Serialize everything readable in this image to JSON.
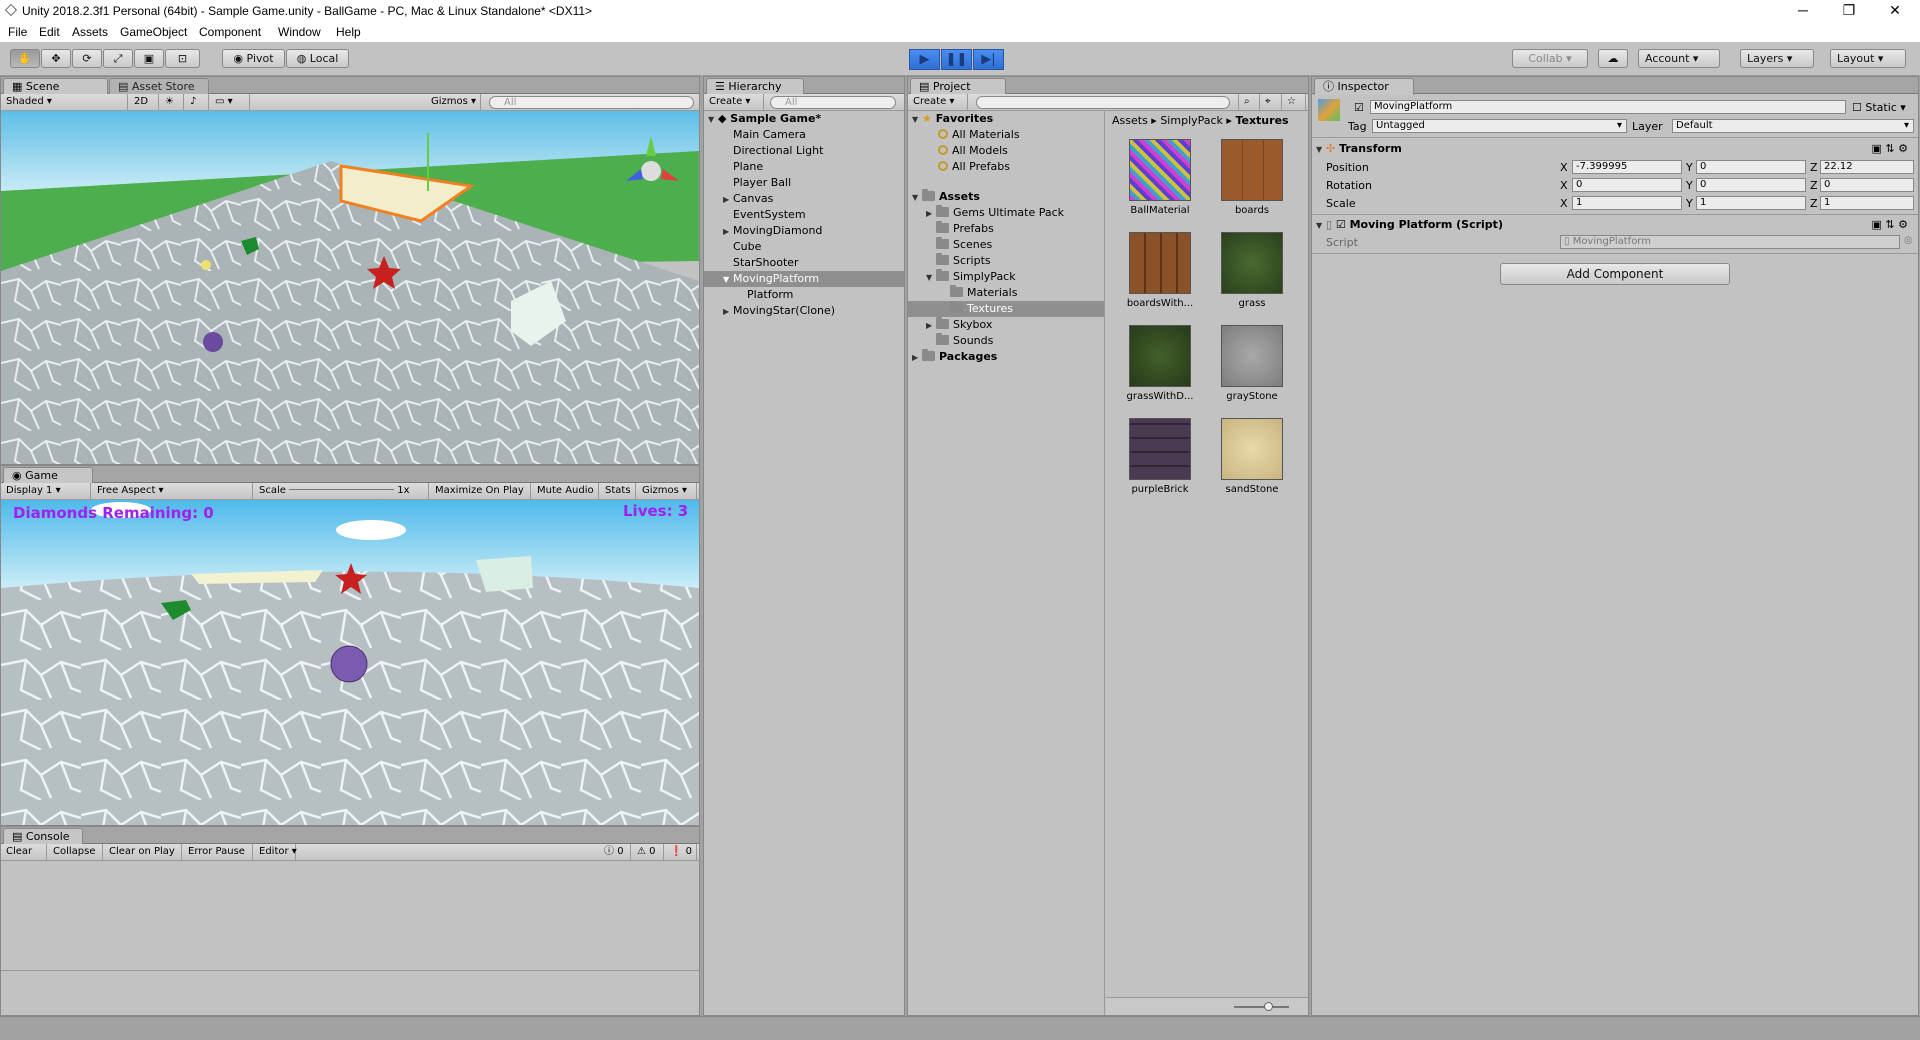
{
  "window": {
    "title": "Unity 2018.2.3f1 Personal (64bit) - Sample Game.unity - BallGame - PC, Mac & Linux Standalone* <DX11>",
    "minimize": "─",
    "restore": "❐",
    "close": "✕"
  },
  "menu": [
    "File",
    "Edit",
    "Assets",
    "GameObject",
    "Component",
    "Window",
    "Help"
  ],
  "toolbar": {
    "pivot": "Pivot",
    "local": "Local",
    "collab": "Collab ▾",
    "account": "Account",
    "layers": "Layers",
    "layout": "Layout",
    "tools": [
      "✋",
      "✥",
      "⟳",
      "⤢",
      "▣",
      "⊡"
    ],
    "play": "▶",
    "pause": "❚❚",
    "step": "▶|"
  },
  "scene": {
    "tabs": [
      "Scene",
      "Asset Store"
    ],
    "shading": "Shaded",
    "mode2d": "2D",
    "gizmos": "Gizmos",
    "search_placeholder": "All"
  },
  "game": {
    "tab": "Game",
    "display": "Display 1",
    "aspect": "Free Aspect",
    "scale_label": "Scale",
    "scale_value": "1x",
    "maximize": "Maximize On Play",
    "mute": "Mute Audio",
    "stats": "Stats",
    "gizmos": "Gizmos",
    "hud_diamonds": "Diamonds Remaining: 0",
    "hud_lives": "Lives: 3"
  },
  "console": {
    "tab": "Console",
    "buttons": [
      "Clear",
      "Collapse",
      "Clear on Play",
      "Error Pause",
      "Editor"
    ],
    "info_count": "0",
    "warn_count": "0",
    "error_count": "0"
  },
  "hierarchy": {
    "tab": "Hierarchy",
    "create": "Create",
    "search_placeholder": "All",
    "scene": "Sample Game*",
    "items": [
      "Main Camera",
      "Directional Light",
      "Plane",
      "Player Ball",
      "Canvas",
      "EventSystem",
      "MovingDiamond",
      "Cube",
      "StarShooter",
      "MovingPlatform",
      "Platform",
      "MovingStar(Clone)"
    ]
  },
  "project": {
    "tab": "Project",
    "create": "Create",
    "favorites": "Favorites",
    "favorite_items": [
      "All Materials",
      "All Models",
      "All Prefabs"
    ],
    "assets": "Assets",
    "folders": [
      "Gems Ultimate Pack",
      "Prefabs",
      "Scenes",
      "Scripts",
      "SimplyPack",
      "Materials",
      "Textures",
      "Skybox",
      "Sounds"
    ],
    "packages": "Packages",
    "breadcrumb": [
      "Assets",
      "SimplyPack",
      "Textures"
    ],
    "thumbnails": [
      {
        "name": "BallMaterial"
      },
      {
        "name": "boards"
      },
      {
        "name": "boardsWith..."
      },
      {
        "name": "grass"
      },
      {
        "name": "grassWithD..."
      },
      {
        "name": "grayStone"
      },
      {
        "name": "purpleBrick"
      },
      {
        "name": "sandStone"
      }
    ]
  },
  "inspector": {
    "tab": "Inspector",
    "object_name": "MovingPlatform",
    "static": "Static",
    "tag_label": "Tag",
    "tag": "Untagged",
    "layer_label": "Layer",
    "layer": "Default",
    "transform": {
      "title": "Transform",
      "position_label": "Position",
      "rotation_label": "Rotation",
      "scale_label": "Scale",
      "position": [
        "-7.399995",
        "0",
        "22.12"
      ],
      "rotation": [
        "0",
        "0",
        "0"
      ],
      "scale": [
        "1",
        "1",
        "1"
      ],
      "axis": [
        "X",
        "Y",
        "Z"
      ]
    },
    "script_component": {
      "title": "Moving Platform (Script)",
      "script_label": "Script",
      "script_value": "MovingPlatform"
    },
    "add_component": "Add Component"
  }
}
